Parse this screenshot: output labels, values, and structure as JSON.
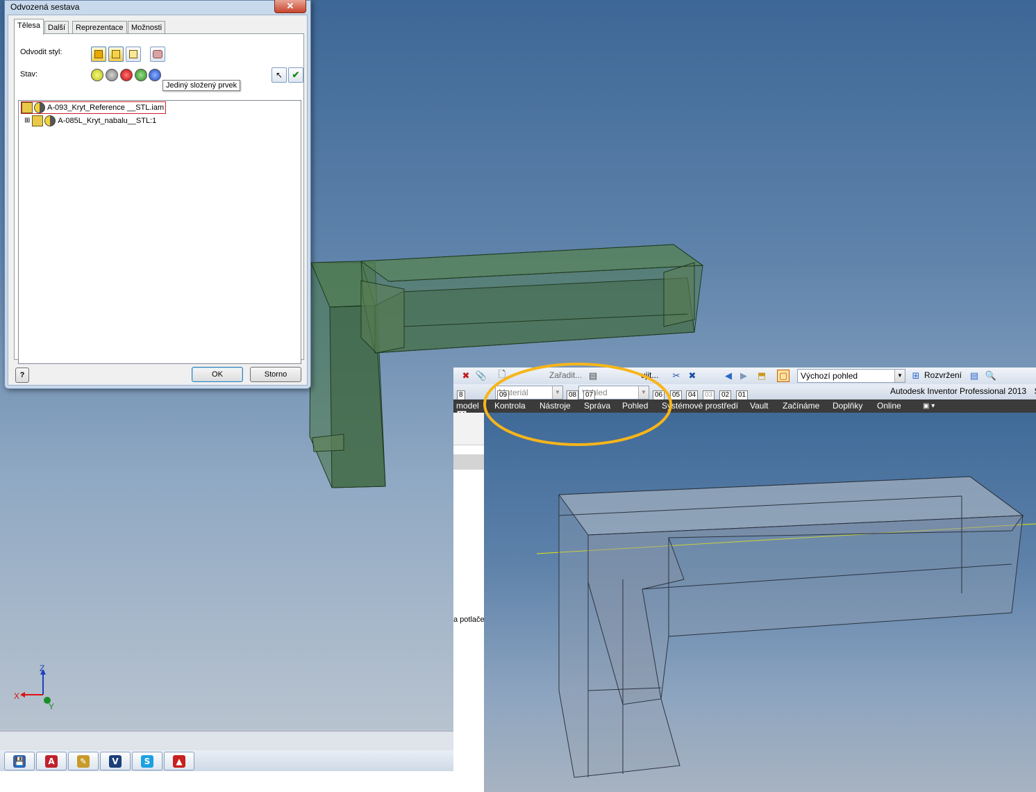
{
  "dialog": {
    "title": "Odvozená sestava",
    "close_glyph": "✕",
    "tabs": [
      "Tělesa",
      "Další",
      "Reprezentace",
      "Možnosti"
    ],
    "derive_style_label": "Odvodit styl:",
    "state_label": "Stav:",
    "tooltip": "Jediný složený prvek",
    "tree": {
      "root": "A-093_Kryt_Reference __STL.iam",
      "child": "A-085L_Kryt_nabalu__STL:1",
      "expander": "⊞"
    },
    "help_glyph": "?",
    "ok_label": "OK",
    "cancel_label": "Storno"
  },
  "triad": {
    "z": "Z",
    "x": "X",
    "y": "Y"
  },
  "taskbar": {
    "apps": [
      {
        "icon": "save-icon",
        "glyph": "💾",
        "color": "#2b5fb8"
      },
      {
        "icon": "autodesk-a-icon",
        "glyph": "A",
        "color": "#c0212a"
      },
      {
        "icon": "inventor-icon",
        "glyph": "✎",
        "color": "#c79a2a"
      },
      {
        "icon": "vault-icon",
        "glyph": "V",
        "color": "#1b3f7a"
      },
      {
        "icon": "skype-icon",
        "glyph": "S",
        "color": "#1ba1e2"
      },
      {
        "icon": "pdf-icon",
        "glyph": "▲",
        "color": "#c8201e"
      }
    ]
  },
  "inventor": {
    "toolbar1": {
      "place_label": "Zařadit...",
      "cut_label": "ujit...",
      "view_combo": "Výchozí pohled",
      "layout_label": "Rozvržení"
    },
    "toolbar2": {
      "material_placeholder": "Materiál",
      "appearance_placeholder": "Vzhled"
    },
    "app_title": "Autodesk Inventor Professional 2013",
    "app_title_cut": "S",
    "keytips": [
      "8",
      "09",
      "08",
      "07",
      "06",
      "05",
      "04",
      "03",
      "02",
      "01"
    ],
    "keytip_m": "M",
    "menu": [
      "model",
      "Kontrola",
      "Nástroje",
      "Správa",
      "Pohled",
      "Systémové prostředí",
      "Vault",
      "Začínáme",
      "Doplňky",
      "Online"
    ],
    "left_panel_text": "a potlače"
  },
  "colors": {
    "highlight_red": "#e0202a",
    "highlight_yellow": "#f7b519",
    "model_green": "#3f6b3c",
    "model_grey": "#8e9aa8"
  }
}
